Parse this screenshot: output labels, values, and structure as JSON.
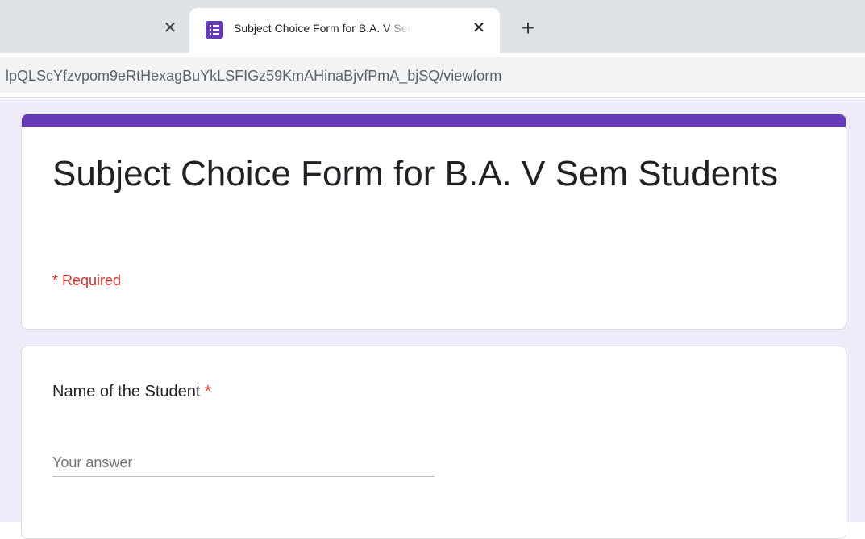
{
  "browser": {
    "prev_tab": {
      "close_glyph": "✕"
    },
    "active_tab": {
      "title": "Subject Choice Form for B.A. V Sem Students",
      "favicon": "google-forms-icon",
      "close_glyph": "✕"
    },
    "new_tab_glyph": "+",
    "address_bar": {
      "url": "lpQLScYfzvpom9eRtHexagBuYkLSFIGz59KmAHinaBjvfPmA_bjSQ/viewform"
    }
  },
  "form": {
    "accent_color": "#673ab7",
    "background_color": "#f0ebf8",
    "title": "Subject Choice Form for B.A. V Sem Students",
    "required_note": "* Required",
    "questions": [
      {
        "label": "Name of the Student",
        "required_marker": "*",
        "placeholder": "Your answer",
        "value": ""
      }
    ]
  }
}
